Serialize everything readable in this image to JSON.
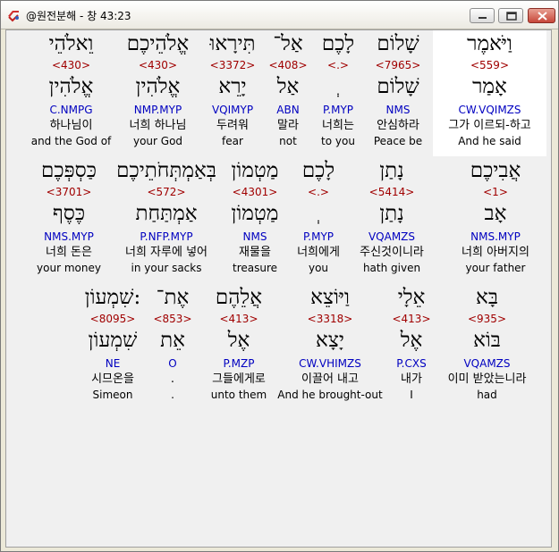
{
  "window": {
    "title": "@원전분해 - 창 43:23"
  },
  "rows": [
    {
      "words": [
        {
          "hebrew": "וַיֹּאמֶר",
          "number": "<559>",
          "root": "אָמַר",
          "code": "CW.VQIMZS",
          "korean": "그가 이르되-하고",
          "english": "And he said"
        },
        {
          "hebrew": "שָׁלוֹם",
          "number": "<7965>",
          "root": "שָׁלוֹם",
          "code": "NMS",
          "korean": "안심하라",
          "english": "Peace be"
        },
        {
          "hebrew": "לָכֶם",
          "number": "<.>",
          "root": "ְ",
          "code": "P.MYP",
          "korean": "너희는",
          "english": "to you"
        },
        {
          "hebrew": "אַל־",
          "number": "<408>",
          "root": "אַל",
          "code": "ABN",
          "korean": "말라",
          "english": "not"
        },
        {
          "hebrew": "תִּירָאוּ",
          "number": "<3372>",
          "root": "יָרֵא",
          "code": "VQIMYP",
          "korean": "두려워",
          "english": "fear"
        },
        {
          "hebrew": "אֱלֹהֵיכֶם",
          "number": "<430>",
          "root": "אֱלֹהִין",
          "code": "NMP.MYP",
          "korean": "너희 하나님",
          "english": "your God"
        },
        {
          "hebrew": "וֵאלֹהֵי",
          "number": "<430>",
          "root": "אֱלֹהִין",
          "code": "C.NMPG",
          "korean": "하나님이",
          "english": "and the God of"
        }
      ]
    },
    {
      "words": [
        {
          "hebrew": "אֲבִיכֶם",
          "number": "<1>",
          "root": "אָב",
          "code": "NMS.MYP",
          "korean": "너희 아버지의",
          "english": "your father"
        },
        {
          "hebrew": "נָתַן",
          "number": "<5414>",
          "root": "נָתַן",
          "code": "VQAMZS",
          "korean": "주신것이니라",
          "english": "hath given"
        },
        {
          "hebrew": "לָכֶם",
          "number": "<.>",
          "root": "ְ",
          "code": "P.MYP",
          "korean": "너희에게",
          "english": "you"
        },
        {
          "hebrew": "מַטְמוֹן",
          "number": "<4301>",
          "root": "מַטְמוֹן",
          "code": "NMS",
          "korean": "재물을",
          "english": "treasure"
        },
        {
          "hebrew": "בְּאַמְתְּחֹתֵיכֶם",
          "number": "<572>",
          "root": "אַמְתַּחַת",
          "code": "P.NFP.MYP",
          "korean": "너희 자루에 넣어",
          "english": "in your sacks"
        },
        {
          "hebrew": "כַּסְפְּכֶם",
          "number": "<3701>",
          "root": "כֶּסֶף",
          "code": "NMS.MYP",
          "korean": "너희 돈은",
          "english": "your money"
        }
      ]
    },
    {
      "words": [
        {
          "hebrew": "בָּא",
          "number": "<935>",
          "root": "בּוֹא",
          "code": "VQAMZS",
          "korean": "이미 받았는니라",
          "english": "had"
        },
        {
          "hebrew": "אֵלָי",
          "number": "<413>",
          "root": "אֶל",
          "code": "P.CXS",
          "korean": "내가",
          "english": "I"
        },
        {
          "hebrew": "וַיּוֹצֵא",
          "number": "<3318>",
          "root": "יָצָא",
          "code": "CW.VHIMZS",
          "korean": "이끌어 내고",
          "english": "And he brought-out"
        },
        {
          "hebrew": "אֲלֵהֶם",
          "number": "<413>",
          "root": "אֶל",
          "code": "P.MZP",
          "korean": "그들에게로",
          "english": "unto them"
        },
        {
          "hebrew": "אֶת־",
          "number": "<853>",
          "root": "אֵת",
          "code": "O",
          "korean": ".",
          "english": "."
        },
        {
          "hebrew": "שִׁמְעוֹן:",
          "number": "<8095>",
          "root": "שִׁמְעוֹן",
          "code": "NE",
          "korean": "시므온을",
          "english": "Simeon"
        }
      ]
    }
  ]
}
